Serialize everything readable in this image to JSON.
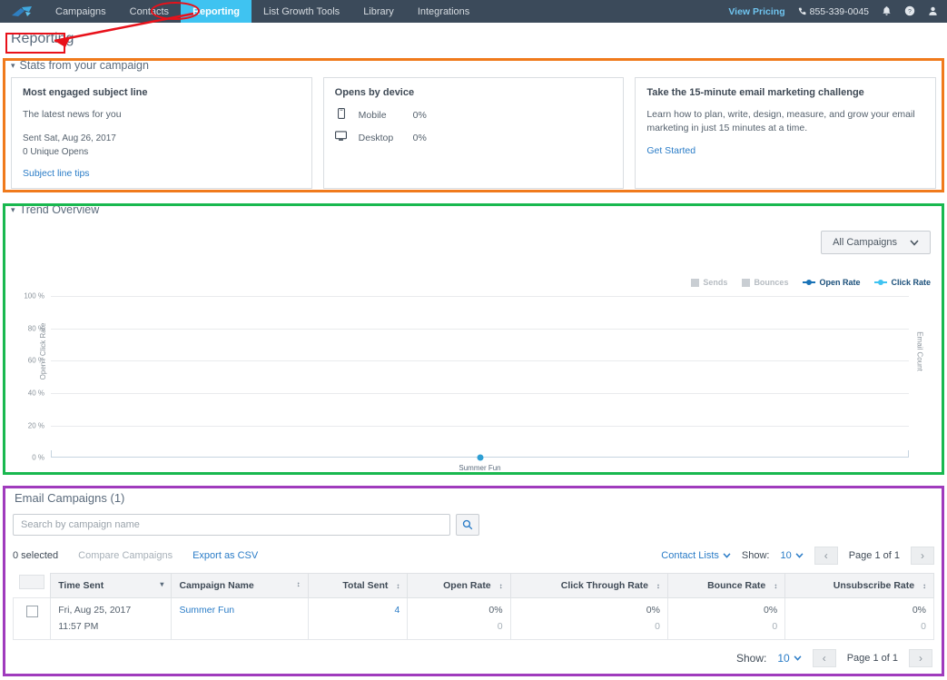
{
  "nav": {
    "logo": "brand-logo-icon",
    "items": [
      {
        "label": "Campaigns",
        "active": false
      },
      {
        "label": "Contacts",
        "active": false
      },
      {
        "label": "Reporting",
        "active": true
      },
      {
        "label": "List Growth Tools",
        "active": false
      },
      {
        "label": "Library",
        "active": false
      },
      {
        "label": "Integrations",
        "active": false
      }
    ],
    "pricing_link": "View Pricing",
    "phone": "855-339-0045",
    "icons": [
      "bell-icon",
      "help-icon",
      "user-icon"
    ]
  },
  "page": {
    "title": "Reporting"
  },
  "stats": {
    "header": "Stats from your campaign",
    "caret": "▾",
    "cards": [
      {
        "title": "Most engaged subject line",
        "subject": "The latest news for you",
        "sent": "Sent Sat, Aug 26, 2017",
        "opens": "0 Unique Opens",
        "link": "Subject line tips"
      },
      {
        "title": "Opens by device",
        "devices": [
          {
            "icon": "mobile-icon",
            "name": "Mobile",
            "value": "0%"
          },
          {
            "icon": "desktop-icon",
            "name": "Desktop",
            "value": "0%"
          }
        ]
      },
      {
        "title": "Take the 15-minute email marketing challenge",
        "body": "Learn how to plan, write, design, measure, and grow your email marketing in just 15 minutes at a time.",
        "link": "Get Started"
      }
    ]
  },
  "trend": {
    "header": "Trend Overview",
    "caret": "▾",
    "campaign_filter": "All Campaigns",
    "chevron": "⌄"
  },
  "chart_data": {
    "type": "scatter",
    "title": "Trend Overview",
    "categories": [
      "Summer Fun"
    ],
    "series": [
      {
        "name": "Sends",
        "type": "bar",
        "color": "#c9ced3",
        "values": [
          0
        ]
      },
      {
        "name": "Bounces",
        "type": "bar",
        "color": "#c9ced3",
        "values": [
          0
        ]
      },
      {
        "name": "Open Rate",
        "type": "line",
        "color": "#1a73b7",
        "values": [
          0
        ]
      },
      {
        "name": "Click Rate",
        "type": "line",
        "color": "#3fc3f1",
        "values": [
          0
        ]
      }
    ],
    "ylabel": "Open / Click Rate",
    "y2label": "Email Count",
    "xlabel": "",
    "yticks": [
      "100 %",
      "80 %",
      "60 %",
      "40 %",
      "20 %",
      "0 %"
    ],
    "ylim": [
      0,
      100
    ],
    "grid": true,
    "legend_position": "top-right"
  },
  "campaigns": {
    "title": "Email Campaigns (1)",
    "search_placeholder": "Search by campaign name",
    "search_value": "",
    "search_icon": "search-icon",
    "selected_count": "0 selected",
    "compare_label": "Compare Campaigns",
    "export_label": "Export as CSV",
    "contact_lists_label": "Contact Lists",
    "show_label": "Show:",
    "show_value": "10",
    "page_label": "Page 1 of 1",
    "prev_icon": "‹",
    "next_icon": "›",
    "columns": [
      {
        "label": "Time Sent",
        "align": "left",
        "sort": "▾"
      },
      {
        "label": "Campaign Name",
        "align": "left",
        "sort": "↕"
      },
      {
        "label": "Total Sent",
        "align": "right",
        "sort": "↕"
      },
      {
        "label": "Open Rate",
        "align": "right",
        "sort": "↕"
      },
      {
        "label": "Click Through Rate",
        "align": "right",
        "sort": "↕"
      },
      {
        "label": "Bounce Rate",
        "align": "right",
        "sort": "↕"
      },
      {
        "label": "Unsubscribe Rate",
        "align": "right",
        "sort": "↕"
      }
    ],
    "rows": [
      {
        "time_date": "Fri, Aug 25, 2017",
        "time_clock": "11:57 PM",
        "name": "Summer Fun",
        "total_sent": "4",
        "open_rate": "0%",
        "open_count": "0",
        "click_rate": "0%",
        "click_count": "0",
        "bounce_rate": "0%",
        "bounce_count": "0",
        "unsub_rate": "0%",
        "unsub_count": "0"
      }
    ]
  },
  "annotations": {
    "title_box_color": "#e8111a",
    "tab_ellipse_color": "#e8111a",
    "arrow_color": "#e8111a",
    "stats_box_color": "#f07a1c",
    "trend_box_color": "#19b84f",
    "campaigns_box_color": "#a03bbd"
  }
}
